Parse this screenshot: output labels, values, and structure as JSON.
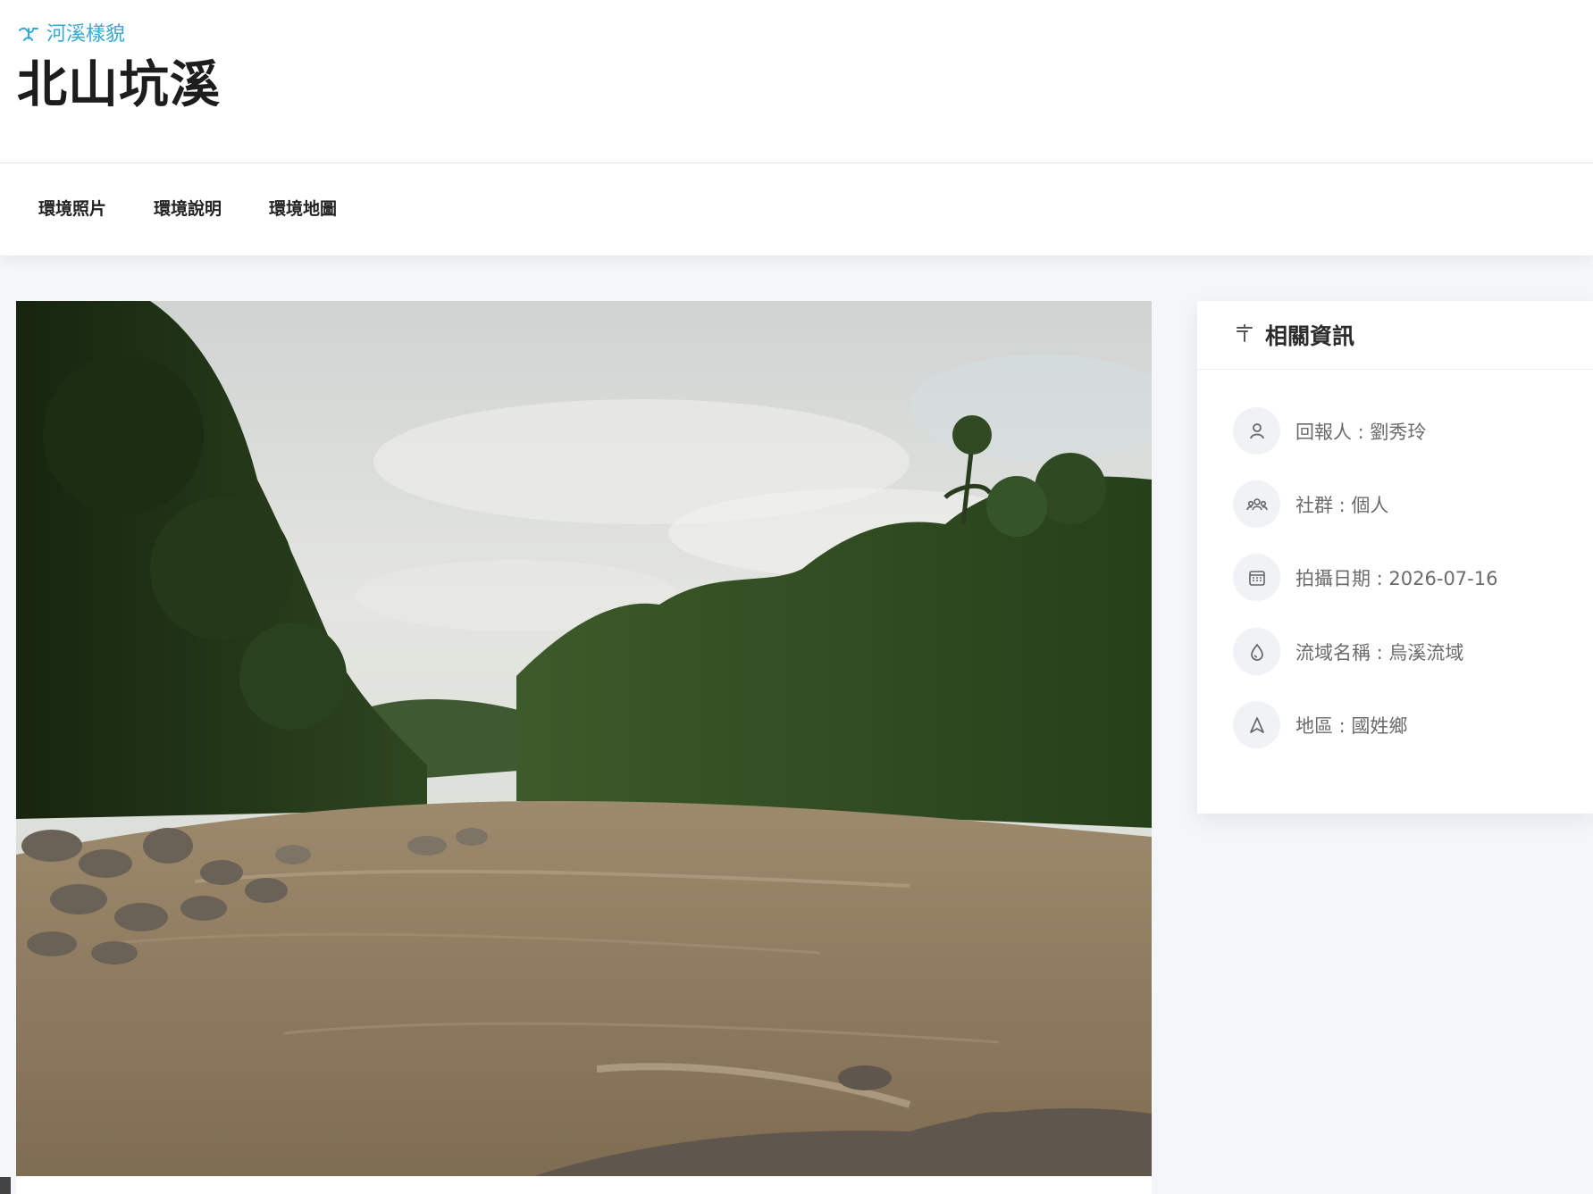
{
  "header": {
    "category_icon": "river-icon",
    "category_label": "河溪樣貌",
    "title": "北山坑溪"
  },
  "tabs": [
    {
      "label": "環境照片"
    },
    {
      "label": "環境說明"
    },
    {
      "label": "環境地圖"
    }
  ],
  "photo": {
    "subject": "river-photo"
  },
  "info": {
    "title": "相關資訊",
    "title_icon": "signpost-icon",
    "items": [
      {
        "icon": "user-icon",
        "text": "回報人 : 劉秀玲"
      },
      {
        "icon": "group-icon",
        "text": "社群 : 個人"
      },
      {
        "icon": "calendar-icon",
        "text": "拍攝日期 : 2026-07-16"
      },
      {
        "icon": "water-drop-icon",
        "text": "流域名稱 : 烏溪流域"
      },
      {
        "icon": "location-icon",
        "text": "地區 : 國姓鄉"
      }
    ]
  },
  "colors": {
    "accent": "#35a8d6",
    "background": "#f4f6f9",
    "icon_circle": "#f1f2f5"
  }
}
